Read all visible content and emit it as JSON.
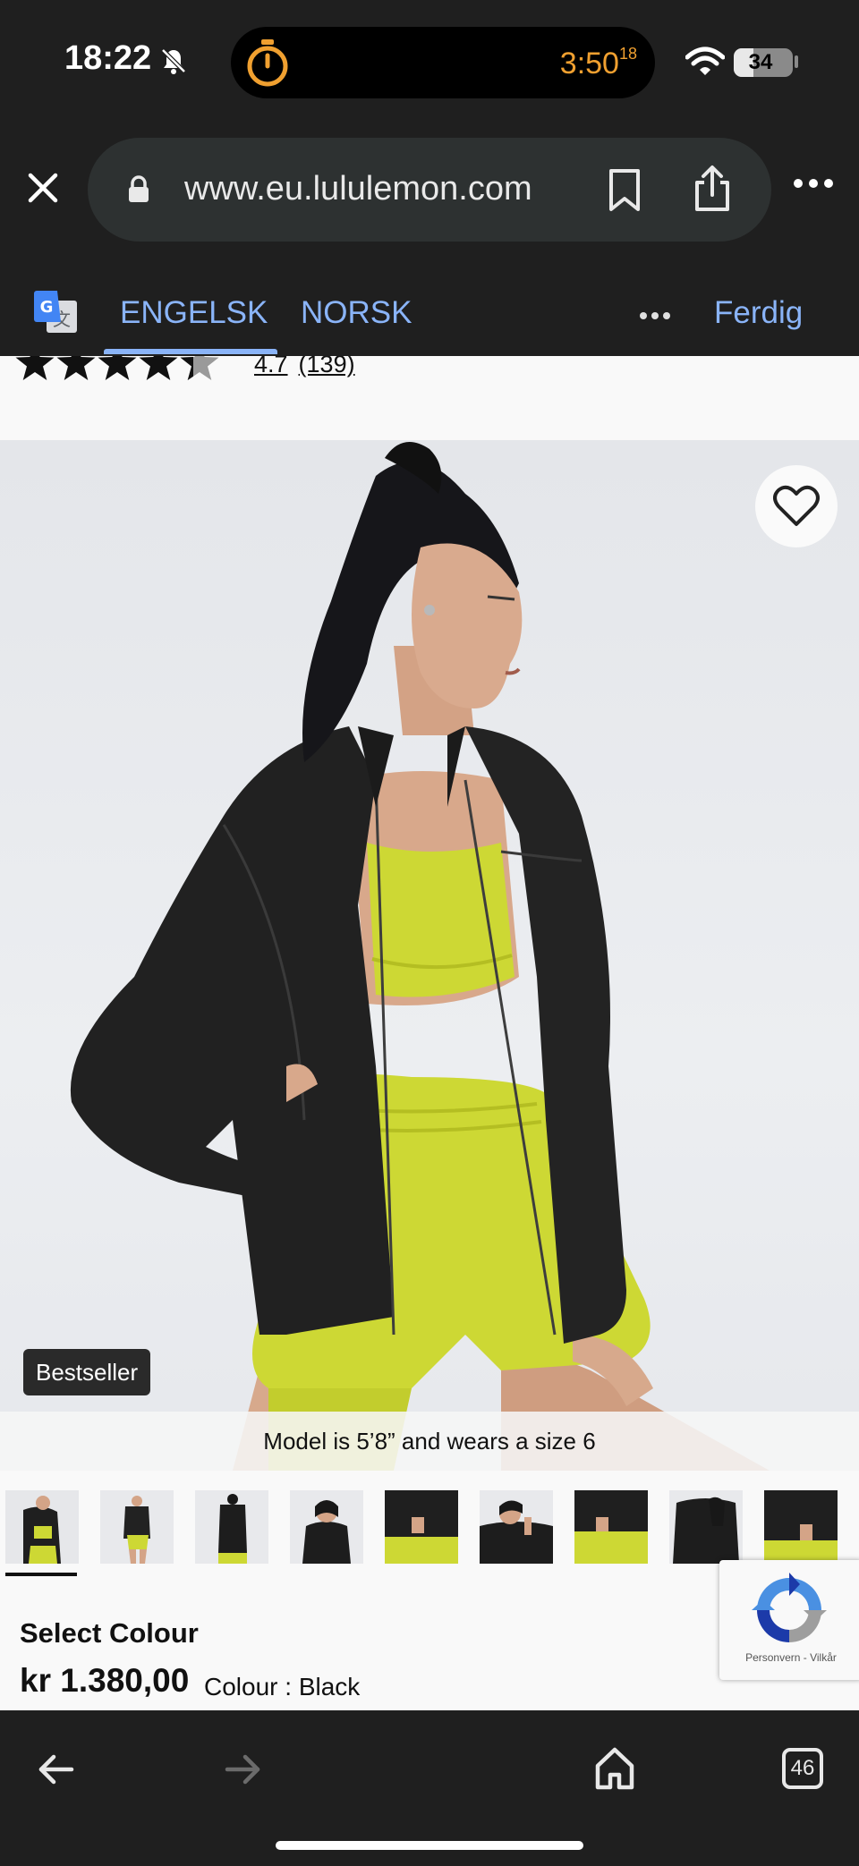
{
  "status_bar": {
    "time": "18:22",
    "timer": "3:50",
    "timer_seconds": "18",
    "battery": "34",
    "battery_level_percent": 34
  },
  "browser": {
    "url": "www.eu.lululemon.com",
    "icons": [
      "close-icon",
      "lock-icon",
      "bookmark-icon",
      "share-icon",
      "more-icon"
    ]
  },
  "translate_bar": {
    "tab_source": "ENGELSK",
    "tab_target": "NORSK",
    "done_label": "Ferdig",
    "active_tab": "ENGELSK"
  },
  "product": {
    "rating_value": "4.7",
    "rating_count": "(139)",
    "stars_filled": 4.7,
    "badge": "Bestseller",
    "model_caption": "Model is 5’8” and wears a size 6",
    "select_colour_heading": "Select Colour",
    "price": "kr 1.380,00",
    "colour_label": "Colour : Black",
    "thumbnail_count": 9,
    "active_thumbnail": 1
  },
  "recaptcha": {
    "text": "Personvern - Vilkår"
  },
  "toolbar": {
    "tab_count": "46"
  },
  "colors": {
    "chrome_bg": "#1f1f1f",
    "link_blue": "#8ab4f8",
    "timer_orange": "#f0a030",
    "product_lime": "#cdd834"
  }
}
